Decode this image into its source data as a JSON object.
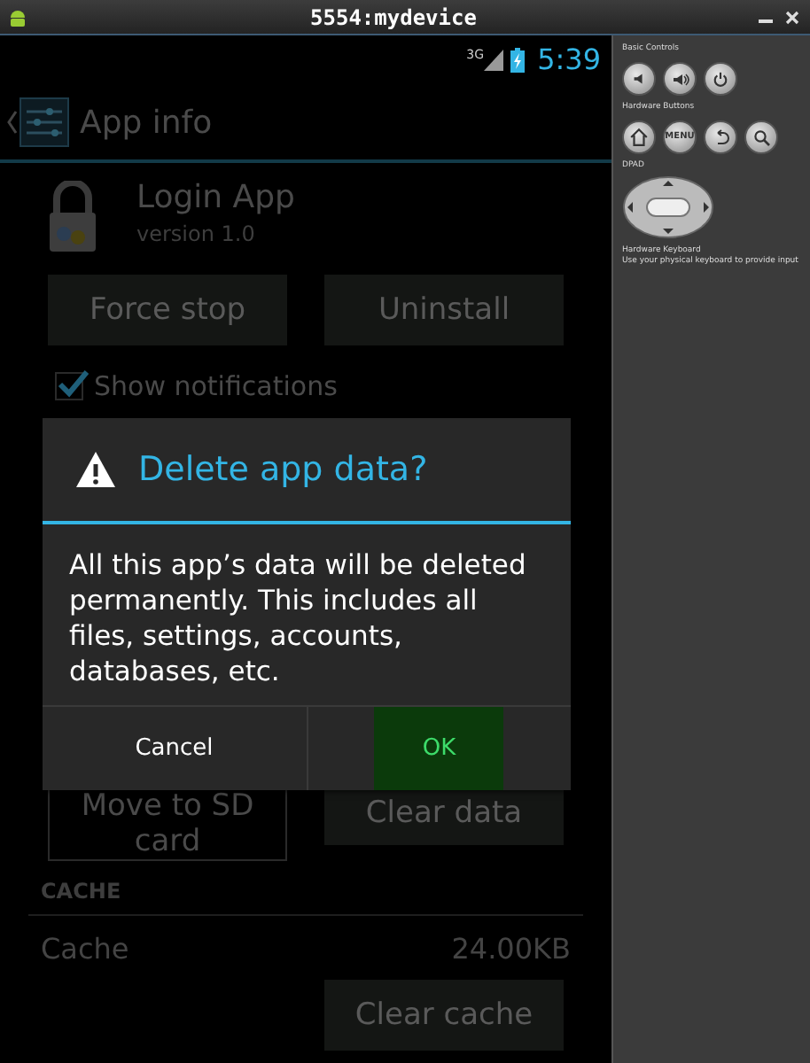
{
  "window": {
    "title": "5554:mydevice"
  },
  "status_bar": {
    "network": "3G",
    "time": "5:39"
  },
  "action_bar": {
    "title": "App info"
  },
  "app": {
    "name": "Login App",
    "version": "version 1.0"
  },
  "top_buttons": [
    "Force stop",
    "Uninstall"
  ],
  "show_notifications": {
    "label": "Show notifications",
    "checked": true
  },
  "storage_buttons": [
    {
      "label": "Move to SD card",
      "disabled": true
    },
    {
      "label": "Clear data",
      "disabled": false
    }
  ],
  "cache": {
    "heading": "CACHE",
    "label": "Cache",
    "value": "24.00KB",
    "button": "Clear cache"
  },
  "dialog": {
    "title": "Delete app data?",
    "message": "All this app’s data will be deleted permanently. This includes all files, settings, accounts, databases, etc.",
    "buttons": [
      {
        "label": "Cancel",
        "selected": false
      },
      {
        "label": "OK",
        "selected": true
      }
    ]
  },
  "controls": {
    "basic_label": "Basic Controls",
    "basic": [
      {
        "kind": "volume_down"
      },
      {
        "kind": "volume_up"
      },
      {
        "kind": "power"
      }
    ],
    "hardware_label": "Hardware Buttons",
    "hardware": [
      {
        "kind": "home"
      },
      {
        "kind": "menu",
        "label": "MENU"
      },
      {
        "kind": "back"
      },
      {
        "kind": "search"
      }
    ],
    "dpad_label": "DPAD",
    "keyboard_label": "Hardware Keyboard",
    "keyboard_hint": "Use your physical keyboard to provide input"
  }
}
